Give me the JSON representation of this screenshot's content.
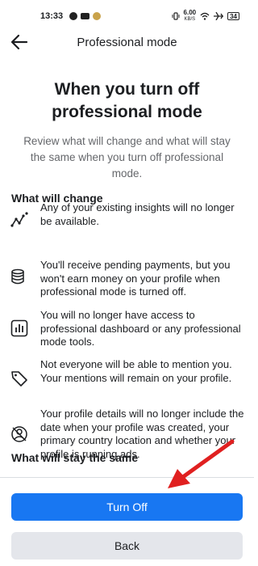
{
  "status_bar": {
    "time": "13:33",
    "speed": "6.00",
    "speed_unit": "KB/S",
    "battery": "34"
  },
  "header": {
    "title": "Professional mode"
  },
  "main": {
    "title": "When you turn off professional mode",
    "subtitle": "Review what will change and what will stay the same when you turn off professional mode.",
    "change_heading": "What will change",
    "changes": [
      {
        "icon": "insights-icon",
        "text": "Any of your existing insights will no longer be available."
      },
      {
        "icon": "payments-icon",
        "text": "You'll receive pending payments, but you won't earn money on your profile when professional mode is turned off."
      },
      {
        "icon": "dashboard-icon",
        "text": "You will no longer have access to professional dashboard or any professional mode tools."
      },
      {
        "icon": "tag-icon",
        "text": "Not everyone will be able to mention you. Your mentions will remain on your profile."
      },
      {
        "icon": "profile-details-icon",
        "text": "Your profile details will no longer include the date when your profile was created, your primary country location and whether your profile is running ads."
      }
    ],
    "stay_heading": "What will stay the same"
  },
  "actions": {
    "turn_off_label": "Turn Off",
    "back_label": "Back"
  },
  "colors": {
    "primary": "#1877f2",
    "secondary_button": "#e4e6eb",
    "annotation": "#e02020"
  }
}
